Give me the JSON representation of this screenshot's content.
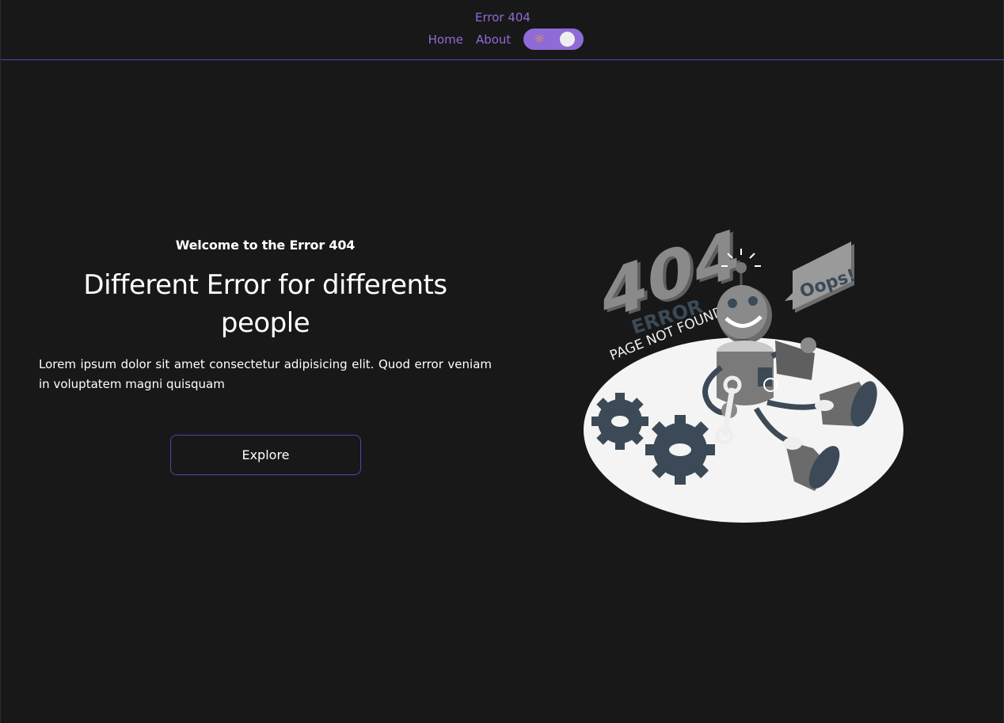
{
  "nav": {
    "brand": "Error 404",
    "links": [
      "Home",
      "About"
    ],
    "theme_toggle_icon": "sun-icon"
  },
  "hero": {
    "eyebrow": "Welcome to the Error 404",
    "headline": "Different Error for differents people",
    "body": "Lorem ipsum dolor sit amet consectetur adipisicing elit. Quod error veniam in voluptatem magni quisquam",
    "cta": "Explore"
  },
  "illustration": {
    "big_number": "404",
    "error_word": "ERROR",
    "subtitle": "PAGE NOT FOUND",
    "speech_bubble": "Oops!"
  },
  "colors": {
    "background": "#181818",
    "accent": "#8e6bd6",
    "border_accent": "#5b3fb0",
    "text": "#ffffff"
  }
}
